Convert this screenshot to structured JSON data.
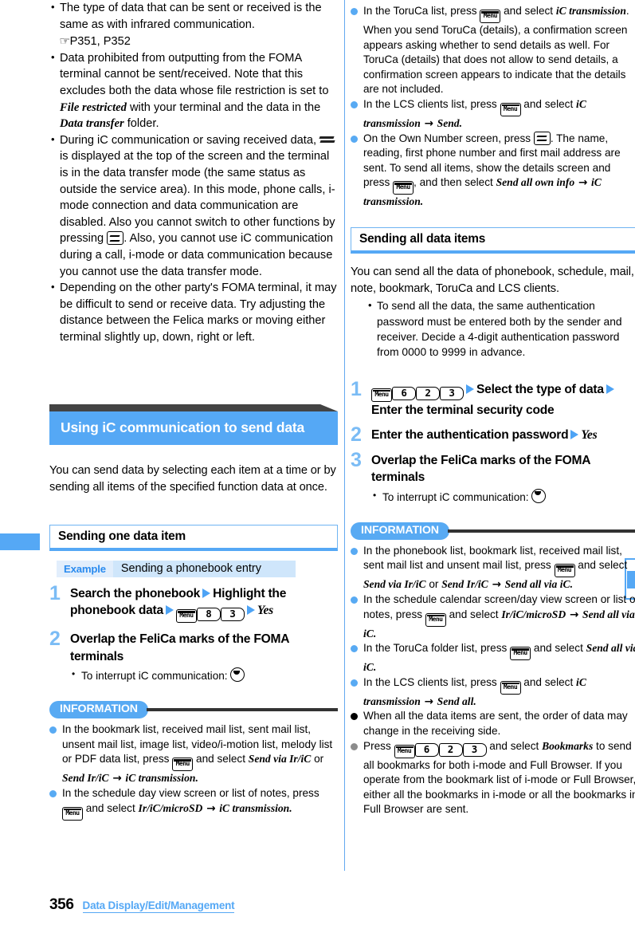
{
  "page": {
    "number": "356",
    "footer_title": "Data Display/Edit/Management"
  },
  "left_column": {
    "top_notes": [
      {
        "text_before": "The type of data that can be sent or received is the same as with infrared communication.",
        "reference": "P351, P352"
      },
      {
        "parts": [
          "Data prohibited from outputting from the FOMA terminal cannot be sent/received. Note that this excludes both the data whose file restriction is set to ",
          "File restricted",
          " with your terminal and the data in the ",
          "Data transfer",
          " folder."
        ]
      },
      {
        "parts": [
          "During iC communication or saving received data, ",
          "[transfer-icon]",
          " is displayed at the top of the screen and the terminal is in the data transfer mode (the same status as outside the service area). In this mode, phone calls, i-mode connection and data communication are disabled. Also you cannot switch to other functions by pressing ",
          "[fn-key]",
          ". Also, you cannot use iC communication during a call, i-mode or data communication because you cannot use the data transfer mode."
        ]
      },
      {
        "parts": [
          "Depending on the other party's FOMA terminal, it may be difficult to send or receive data. Try adjusting the distance between the Felica marks or moving either terminal slightly up, down, right or left."
        ]
      }
    ],
    "section_header": "Using iC communication to send data",
    "section_intro": "You can send data by selecting each item at a time or by sending all items of the specified function data at once.",
    "sub_header": "Sending one data item",
    "example": {
      "tag": "Example",
      "text": "Sending a phonebook entry"
    },
    "steps": [
      {
        "num": "1",
        "segments": [
          {
            "type": "text",
            "value": "Search the phonebook"
          },
          {
            "type": "tri"
          },
          {
            "type": "text",
            "value": "Highlight the phonebook data"
          },
          {
            "type": "tri"
          },
          {
            "type": "key-menu",
            "value": "Menu"
          },
          {
            "type": "key-num",
            "value": "8"
          },
          {
            "type": "key-num",
            "value": "3"
          },
          {
            "type": "tri"
          },
          {
            "type": "em",
            "value": "Yes"
          }
        ]
      },
      {
        "num": "2",
        "segments": [
          {
            "type": "text",
            "value": "Overlap the FeliCa marks of the FOMA terminals"
          }
        ],
        "sub": "To interrupt iC communication:"
      }
    ],
    "information": {
      "badge": "INFORMATION",
      "items": [
        {
          "dot": "blue",
          "parts": [
            {
              "t": "n",
              "v": "In the bookmark list, received mail list, sent mail list, unsent mail list, image list, video/i-motion list, melody list or PDF data list, press "
            },
            {
              "t": "key-menu",
              "v": "Menu"
            },
            {
              "t": "n",
              "v": " and select "
            },
            {
              "t": "i",
              "v": "Send via Ir/iC"
            },
            {
              "t": "n",
              "v": " or "
            },
            {
              "t": "i",
              "v": "Send Ir/iC"
            },
            {
              "t": "arw",
              "v": " → "
            },
            {
              "t": "i",
              "v": "iC transmission"
            },
            {
              "t": "n",
              "v": "."
            }
          ]
        },
        {
          "dot": "blue",
          "parts": [
            {
              "t": "n",
              "v": "In the schedule day view screen or list of notes, press "
            },
            {
              "t": "key-menu",
              "v": "Menu"
            },
            {
              "t": "n",
              "v": " and select "
            },
            {
              "t": "i",
              "v": "Ir/iC/microSD"
            },
            {
              "t": "arw",
              "v": " → "
            },
            {
              "t": "i",
              "v": "iC transmission"
            },
            {
              "t": "n",
              "v": "."
            }
          ]
        }
      ]
    }
  },
  "right_column": {
    "top_information_items": [
      {
        "dot": "blue",
        "parts": [
          {
            "t": "n",
            "v": "In the ToruCa list, press "
          },
          {
            "t": "key-menu",
            "v": "Menu"
          },
          {
            "t": "n",
            "v": " and select "
          },
          {
            "t": "i",
            "v": "iC transmission"
          },
          {
            "t": "n",
            "v": ". When you send ToruCa (details), a confirmation screen appears asking whether to send details as well. For ToruCa (details) that does not allow to send details, a confirmation screen appears to indicate that the details are not included."
          }
        ]
      },
      {
        "dot": "blue",
        "parts": [
          {
            "t": "n",
            "v": "In the LCS clients list, press "
          },
          {
            "t": "key-menu",
            "v": "Menu"
          },
          {
            "t": "n",
            "v": " and select "
          },
          {
            "t": "i",
            "v": "iC transmission"
          },
          {
            "t": "arw",
            "v": " → "
          },
          {
            "t": "i",
            "v": "Send"
          },
          {
            "t": "n",
            "v": "."
          }
        ]
      },
      {
        "dot": "blue",
        "parts": [
          {
            "t": "n",
            "v": "On the Own Number screen, press "
          },
          {
            "t": "key-fn",
            "v": "fn"
          },
          {
            "t": "n",
            "v": ". The name, reading, first phone number and first mail address are sent. To send all items, show the details screen and press "
          },
          {
            "t": "key-menu",
            "v": "Menu"
          },
          {
            "t": "n",
            "v": ", and then select "
          },
          {
            "t": "i",
            "v": "Send all own info"
          },
          {
            "t": "arw",
            "v": " → "
          },
          {
            "t": "i",
            "v": "iC transmission"
          },
          {
            "t": "n",
            "v": "."
          }
        ]
      }
    ],
    "sub_header": "Sending all data items",
    "intro": "You can send all the data of phonebook, schedule, mail, note, bookmark, ToruCa and LCS clients.",
    "intro_bullet": "To send all the data, the same authentication password must be entered both by the sender and receiver. Decide a 4-digit authentication password from 0000 to 9999 in advance.",
    "steps": [
      {
        "num": "1",
        "segments": [
          {
            "type": "key-menu",
            "value": "Menu"
          },
          {
            "type": "key-num",
            "value": "6"
          },
          {
            "type": "key-num",
            "value": "2"
          },
          {
            "type": "key-num",
            "value": "3"
          },
          {
            "type": "tri"
          },
          {
            "type": "text",
            "value": "Select the type of data"
          },
          {
            "type": "tri"
          },
          {
            "type": "text",
            "value": "Enter the terminal security code"
          }
        ]
      },
      {
        "num": "2",
        "segments": [
          {
            "type": "text",
            "value": "Enter the authentication password"
          },
          {
            "type": "tri"
          },
          {
            "type": "em",
            "value": "Yes"
          }
        ]
      },
      {
        "num": "3",
        "segments": [
          {
            "type": "text",
            "value": "Overlap the FeliCa marks of the FOMA terminals"
          }
        ],
        "sub": "To interrupt iC communication:"
      }
    ],
    "information": {
      "badge": "INFORMATION",
      "items": [
        {
          "dot": "blue",
          "parts": [
            {
              "t": "n",
              "v": "In the phonebook list, bookmark list, received mail list, sent mail list and unsent mail list, press "
            },
            {
              "t": "key-menu",
              "v": "Menu"
            },
            {
              "t": "n",
              "v": " and select "
            },
            {
              "t": "i",
              "v": "Send via Ir/iC"
            },
            {
              "t": "n",
              "v": " or "
            },
            {
              "t": "i",
              "v": "Send Ir/iC"
            },
            {
              "t": "arw",
              "v": " → "
            },
            {
              "t": "i",
              "v": "Send all via iC"
            },
            {
              "t": "n",
              "v": "."
            }
          ]
        },
        {
          "dot": "blue",
          "parts": [
            {
              "t": "n",
              "v": "In the schedule calendar screen/day view screen or list of notes, press "
            },
            {
              "t": "key-menu",
              "v": "Menu"
            },
            {
              "t": "n",
              "v": " and select "
            },
            {
              "t": "i",
              "v": "Ir/iC/microSD"
            },
            {
              "t": "arw",
              "v": " → "
            },
            {
              "t": "i",
              "v": "Send all via iC"
            },
            {
              "t": "n",
              "v": "."
            }
          ]
        },
        {
          "dot": "blue",
          "parts": [
            {
              "t": "n",
              "v": "In the ToruCa folder list, press "
            },
            {
              "t": "key-menu",
              "v": "Menu"
            },
            {
              "t": "n",
              "v": " and select "
            },
            {
              "t": "i",
              "v": "Send all via iC"
            },
            {
              "t": "n",
              "v": "."
            }
          ]
        },
        {
          "dot": "blue",
          "parts": [
            {
              "t": "n",
              "v": "In the LCS clients list, press "
            },
            {
              "t": "key-menu",
              "v": "Menu"
            },
            {
              "t": "n",
              "v": " and select "
            },
            {
              "t": "i",
              "v": "iC transmission"
            },
            {
              "t": "arw",
              "v": " → "
            },
            {
              "t": "i",
              "v": "Send all"
            },
            {
              "t": "n",
              "v": "."
            }
          ]
        },
        {
          "dot": "black",
          "parts": [
            {
              "t": "n",
              "v": "When all the data items are sent, the order of data may change in the receiving side."
            }
          ]
        },
        {
          "dot": "gray",
          "parts": [
            {
              "t": "n",
              "v": "Press "
            },
            {
              "t": "key-menu",
              "v": "Menu"
            },
            {
              "t": "key-num",
              "v": "6"
            },
            {
              "t": "key-num",
              "v": "2"
            },
            {
              "t": "key-num",
              "v": "3"
            },
            {
              "t": "n",
              "v": " and select "
            },
            {
              "t": "i",
              "v": "Bookmarks"
            },
            {
              "t": "n",
              "v": " to send all bookmarks for both i-mode and Full Browser. If you operate from the bookmark list of i-mode or Full Browser, either all the bookmarks in i-mode or all the bookmarks in Full Browser are sent."
            }
          ]
        }
      ]
    }
  },
  "colors": {
    "accent_blue": "#55a8f5",
    "header_dark": "#434343",
    "example_band": "#cfe6fb",
    "step_number": "#7bbcf5"
  }
}
